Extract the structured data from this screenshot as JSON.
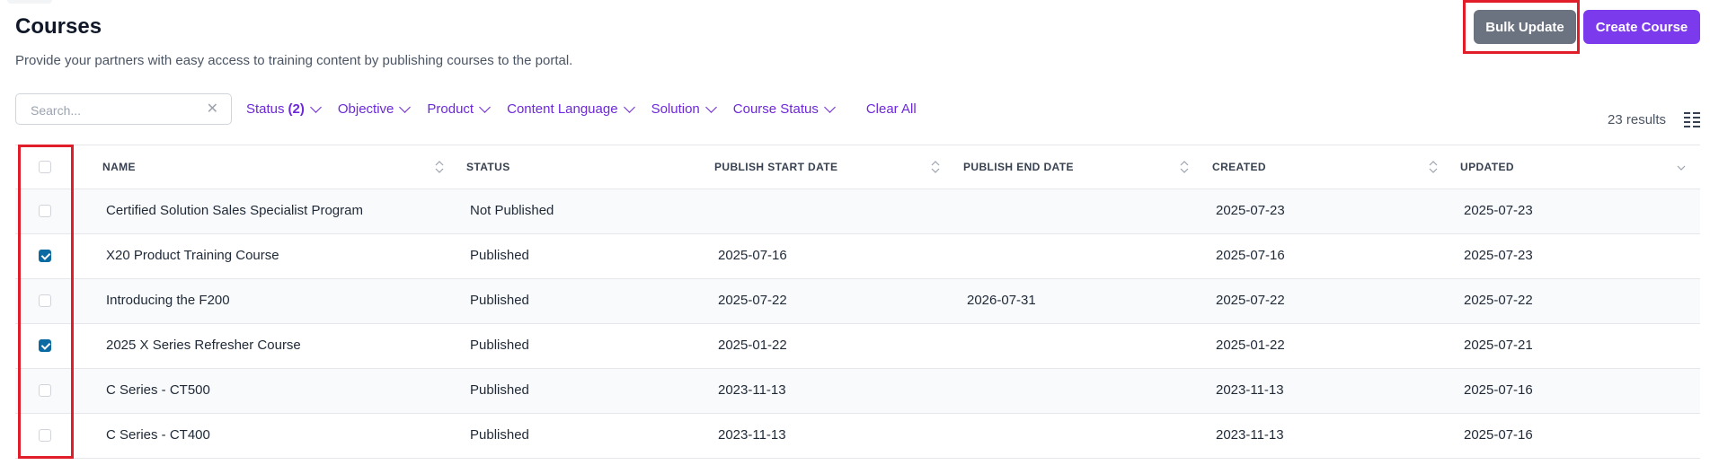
{
  "page": {
    "title": "Courses",
    "subtitle": "Provide your partners with easy access to training content by publishing courses to the portal."
  },
  "actions": {
    "bulk_update": "Bulk Update",
    "create_course": "Create Course"
  },
  "search": {
    "placeholder": "Search...",
    "clear_icon": "close-icon"
  },
  "filters": [
    {
      "label": "Status",
      "count": "(2)"
    },
    {
      "label": "Objective"
    },
    {
      "label": "Product"
    },
    {
      "label": "Content Language"
    },
    {
      "label": "Solution"
    },
    {
      "label": "Course Status"
    }
  ],
  "clear_all": "Clear All",
  "results": "23 results",
  "columns": [
    "NAME",
    "STATUS",
    "PUBLISH START DATE",
    "PUBLISH END DATE",
    "CREATED",
    "UPDATED"
  ],
  "rows": [
    {
      "checked": false,
      "name": "Certified Solution Sales Specialist Program",
      "status": "Not Published",
      "start": "",
      "end": "",
      "created": "2025-07-23",
      "updated": "2025-07-23"
    },
    {
      "checked": true,
      "name": "X20 Product Training Course",
      "status": "Published",
      "start": "2025-07-16",
      "end": "",
      "created": "2025-07-16",
      "updated": "2025-07-23"
    },
    {
      "checked": false,
      "name": "Introducing the F200",
      "status": "Published",
      "start": "2025-07-22",
      "end": "2026-07-31",
      "created": "2025-07-22",
      "updated": "2025-07-22"
    },
    {
      "checked": true,
      "name": "2025 X Series Refresher Course",
      "status": "Published",
      "start": "2025-01-22",
      "end": "",
      "created": "2025-01-22",
      "updated": "2025-07-21"
    },
    {
      "checked": false,
      "name": "C Series - CT500",
      "status": "Published",
      "start": "2023-11-13",
      "end": "",
      "created": "2023-11-13",
      "updated": "2025-07-16"
    },
    {
      "checked": false,
      "name": "C Series - CT400",
      "status": "Published",
      "start": "2023-11-13",
      "end": "",
      "created": "2023-11-13",
      "updated": "2025-07-16"
    }
  ],
  "colors": {
    "accent": "#7c3aed",
    "checkbox": "#0b6aa2",
    "highlight": "#e11d2a",
    "bulk_button": "#6b7280"
  }
}
